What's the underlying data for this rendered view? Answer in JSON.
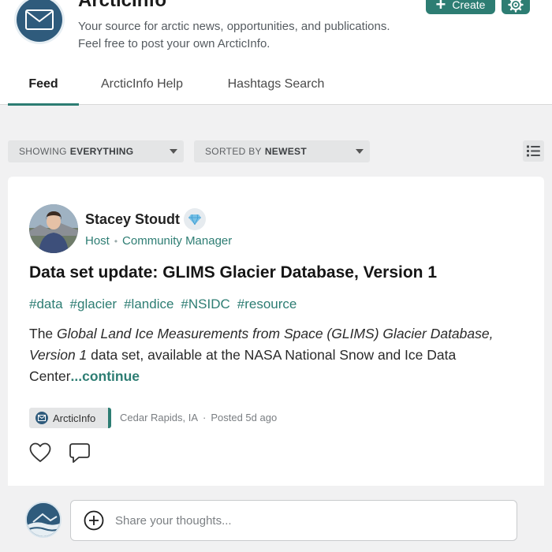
{
  "app": {
    "title": "ArcticInfo",
    "description_line1": "Your source for arctic news, opportunities, and publications.",
    "description_line2": "Feel free to post your own ArcticInfo.",
    "create_label": "Create",
    "accent_color": "#2d7d73"
  },
  "tabs": [
    {
      "label": "Feed",
      "active": true
    },
    {
      "label": "ArcticInfo Help",
      "active": false
    },
    {
      "label": "Hashtags Search",
      "active": false
    }
  ],
  "filters": {
    "showing_prefix": "SHOWING",
    "showing_value": "EVERYTHING",
    "sorted_prefix": "SORTED BY",
    "sorted_value": "NEWEST"
  },
  "post": {
    "author_name": "Stacey Stoudt",
    "author_role": "Host",
    "author_title": "Community Manager",
    "title": "Data set update: GLIMS Glacier Database, Version 1",
    "hashtags": [
      "#data",
      "#glacier",
      "#landice",
      "#NSIDC",
      "#resource"
    ],
    "body_intro": "The ",
    "body_italic": "Global Land Ice Measurements from Space (GLIMS) Glacier Database, Version 1",
    "body_rest": " data set, available at the NASA National Snow and Ice Data Center",
    "continue_label": "...continue",
    "source": "ArcticInfo",
    "location": "Cedar Rapids, IA",
    "posted": "Posted 5d ago"
  },
  "composer": {
    "placeholder": "Share your thoughts..."
  }
}
